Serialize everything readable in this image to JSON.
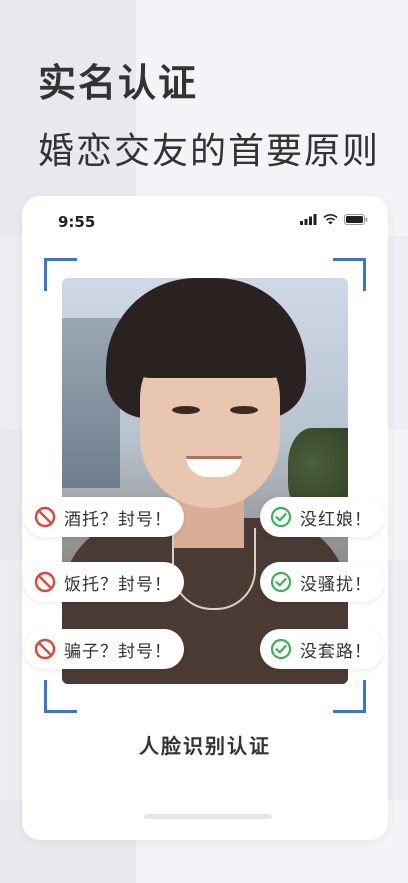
{
  "hero": {
    "title": "实名认证",
    "subtitle": "婚恋交友的首要原则"
  },
  "status_bar": {
    "time": "9:55"
  },
  "chips_negative": [
    {
      "label": "酒托？封号！",
      "icon": "prohibited-icon"
    },
    {
      "label": "饭托？封号！",
      "icon": "prohibited-icon"
    },
    {
      "label": "骗子？封号！",
      "icon": "prohibited-icon"
    }
  ],
  "chips_positive": [
    {
      "label": "没红娘！",
      "icon": "check-circle-icon"
    },
    {
      "label": "没骚扰！",
      "icon": "check-circle-icon"
    },
    {
      "label": "没套路！",
      "icon": "check-circle-icon"
    }
  ],
  "verify_label": "人脸识别认证",
  "colors": {
    "frame_accent": "#3f73cf",
    "prohibited": "#e0453a",
    "check": "#3bb15a"
  }
}
